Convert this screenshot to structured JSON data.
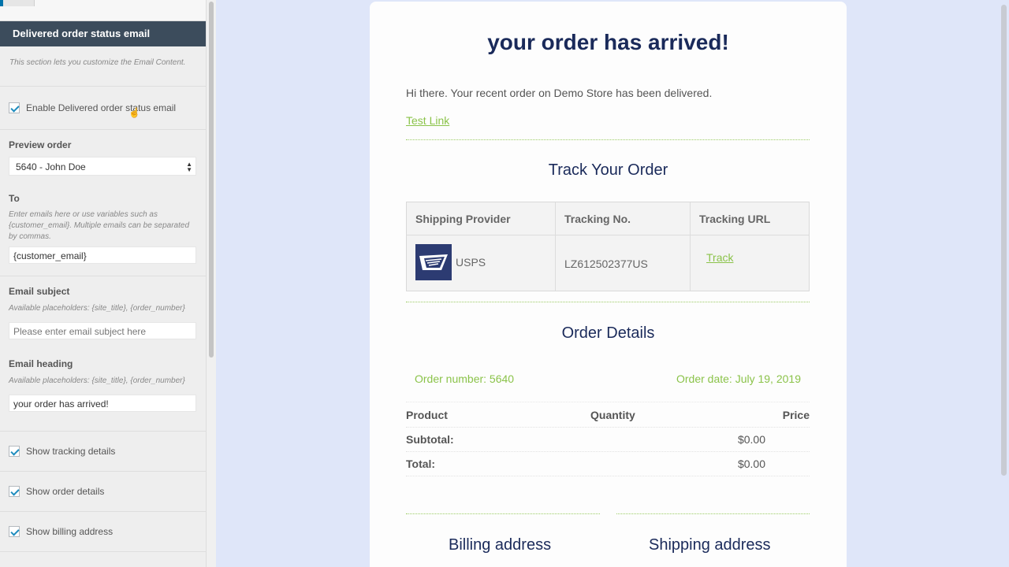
{
  "sidebar": {
    "section_title": "Delivered order status email",
    "section_description": "This section lets you customize the Email Content.",
    "enable_label": "Enable Delivered order status email",
    "enable_checked": true,
    "preview_order": {
      "label": "Preview order",
      "selected": "5640 - John Doe"
    },
    "to": {
      "label": "To",
      "description": "Enter emails here or use variables such as {customer_email}. Multiple emails can be separated by commas.",
      "value": "{customer_email}"
    },
    "email_subject": {
      "label": "Email subject",
      "description": "Available placeholders: {site_title}, {order_number}",
      "placeholder": "Please enter email subject here"
    },
    "email_heading": {
      "label": "Email heading",
      "description": "Available placeholders: {site_title}, {order_number}",
      "value": "your order has arrived!"
    },
    "toggles": [
      {
        "label": "Show tracking details",
        "checked": true
      },
      {
        "label": "Show order details",
        "checked": true
      },
      {
        "label": "Show billing address",
        "checked": true
      }
    ]
  },
  "email": {
    "heading": "your order has arrived!",
    "intro": "Hi there. Your recent order on Demo Store has been delivered.",
    "test_link": "Test Link",
    "track_title": "Track Your Order",
    "tracking_table": {
      "headers": [
        "Shipping Provider",
        "Tracking No.",
        "Tracking URL"
      ],
      "row": {
        "provider": "USPS",
        "tracking_no": "LZ612502377US",
        "url_label": "Track"
      }
    },
    "order_title": "Order Details",
    "order_number": "Order number: 5640",
    "order_date": "Order date: July 19, 2019",
    "order_headers": [
      "Product",
      "Quantity",
      "Price"
    ],
    "subtotal": {
      "label": "Subtotal:",
      "value": "$0.00"
    },
    "total": {
      "label": "Total:",
      "value": "$0.00"
    },
    "billing_title": "Billing address",
    "shipping_title": "Shipping address"
  },
  "colors": {
    "page_background": "#dfe6f9",
    "sidebar_header": "#3c4c5c",
    "heading_navy": "#1a2a5a",
    "link_green": "#8bc34a",
    "checkbox_blue": "#1e8cbe"
  },
  "icons": [
    "usps-eagle-logo",
    "checkmark-icon",
    "select-arrows-icon",
    "hand-cursor-icon"
  ]
}
